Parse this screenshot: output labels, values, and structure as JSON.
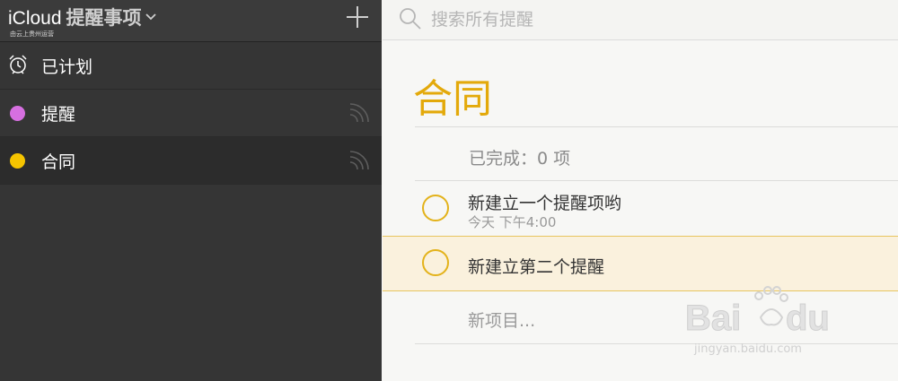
{
  "sidebar": {
    "brand": "iCloud",
    "app_name": "提醒事项",
    "operator": "由云上贵州运营",
    "items": [
      {
        "label": "已计划",
        "icon": "alarm-clock-icon"
      },
      {
        "label": "提醒",
        "color": "#d66fe0",
        "icon": "share-icon"
      },
      {
        "label": "合同",
        "color": "#f5c400",
        "icon": "share-icon"
      }
    ],
    "add_icon": "plus-icon"
  },
  "search": {
    "placeholder": "搜索所有提醒",
    "icon": "search-icon"
  },
  "list": {
    "title": "合同",
    "title_color": "#e3a90a",
    "completed": "已完成：0 项",
    "reminders": [
      {
        "title": "新建立一个提醒项哟",
        "subtitle": "今天 下午4:00"
      },
      {
        "title": "新建立第二个提醒",
        "subtitle": ""
      }
    ],
    "new_item": "新项目..."
  },
  "watermark": {
    "url": "jingyan.baidu.com"
  }
}
